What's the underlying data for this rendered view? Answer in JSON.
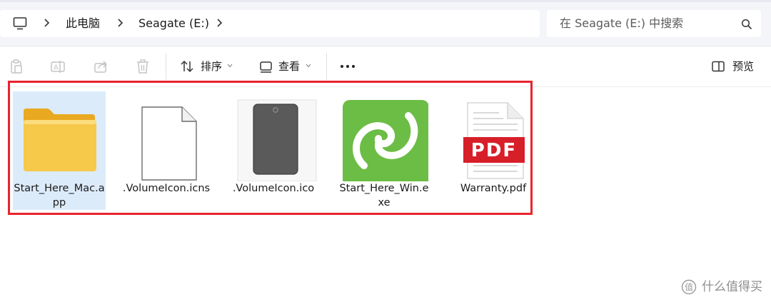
{
  "address_bar": {
    "breadcrumbs": [
      {
        "label": "此电脑"
      },
      {
        "label": "Seagate (E:)"
      }
    ],
    "search_placeholder": "在 Seagate (E:) 中搜索"
  },
  "command_bar": {
    "sort_label": "排序",
    "view_label": "查看",
    "preview_label": "预览"
  },
  "files": [
    {
      "name": "Start_Here_Mac.app",
      "type": "folder",
      "selected": true
    },
    {
      "name": ".VolumeIcon.icns",
      "type": "generic-file",
      "selected": false
    },
    {
      "name": ".VolumeIcon.ico",
      "type": "drive-image",
      "selected": false
    },
    {
      "name": "Start_Here_Win.exe",
      "type": "seagate-app",
      "selected": false
    },
    {
      "name": "Warranty.pdf",
      "type": "pdf",
      "selected": false
    }
  ],
  "pdf_badge": "PDF",
  "watermark": "什么值得买",
  "colors": {
    "highlight": "#e8242e",
    "selection": "#dcebfa",
    "folder": "#f6c94a",
    "seagate_green": "#6cbd45",
    "pdf_red": "#d71f2a"
  }
}
